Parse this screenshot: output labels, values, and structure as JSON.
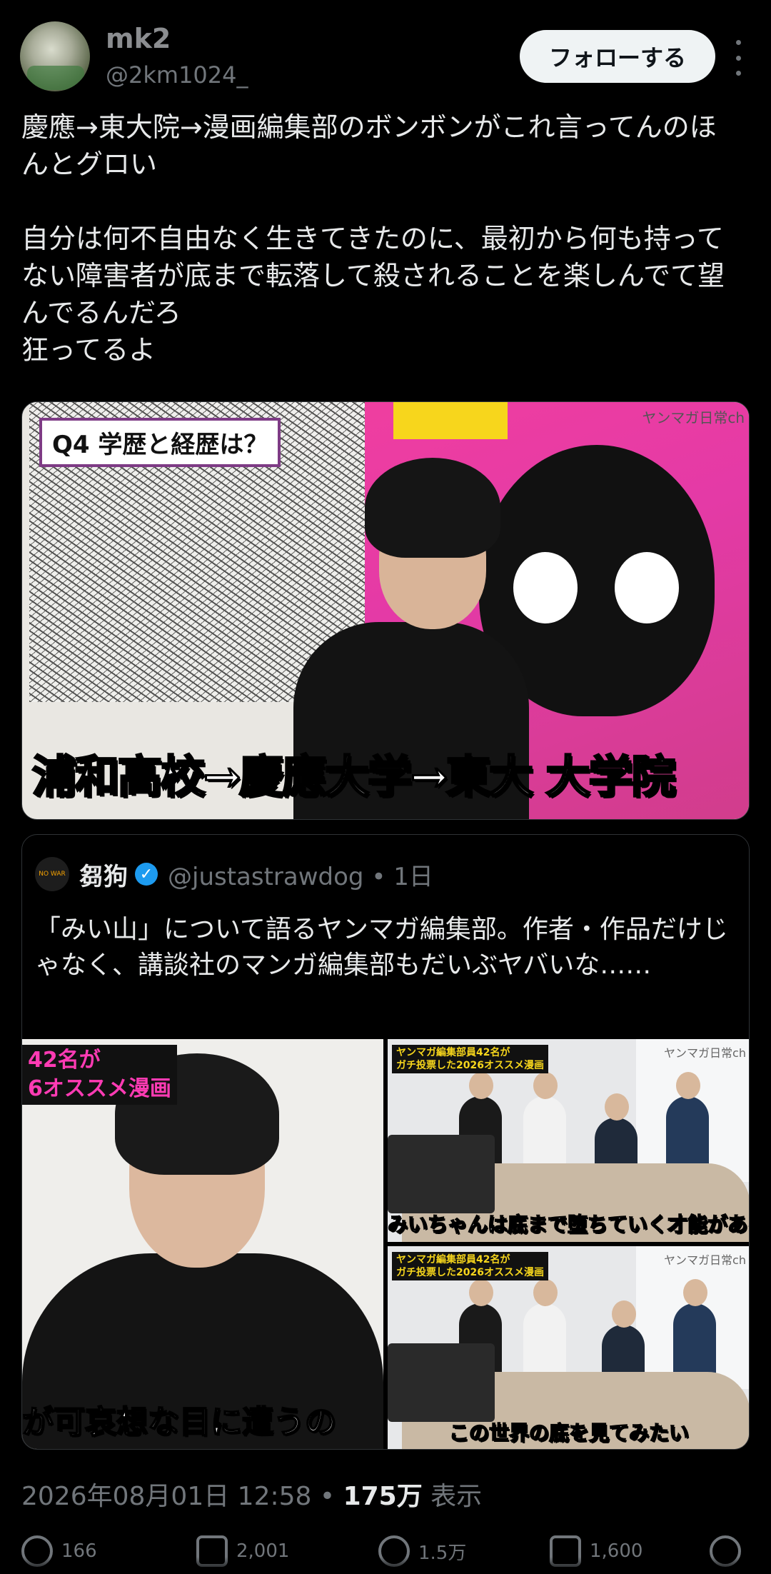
{
  "author": {
    "name": "mk2",
    "handle": "@2km1024_",
    "follow_label": "フォローする"
  },
  "post": {
    "text": "慶應→東大院→漫画編集部のボンボンがこれ言ってんのほんとグロい\n\n自分は何不自由なく生きてきたのに、最初から何も持ってない障害者が底まで転落して殺されることを楽しんでて望んでるんだろ\n狂ってるよ"
  },
  "media": {
    "question_label": "Q4 学歴と経歴は？",
    "watermark": "ヤンマガ日常ch",
    "caption": "浦和高校→慶應大学→東大 大学院"
  },
  "quote": {
    "name": "芻狗",
    "handle": "@justastrawdog",
    "time": "1日",
    "avatar_text": "NO WAR",
    "text": "「みい山」について語るヤンマガ編集部。作者・作品だけじゃなく、講談社のマンガ編集部もだいぶヤバいな……",
    "image1": {
      "banner_top": "42名が",
      "banner_bottom": "6オススメ漫画",
      "subtitle": "が可哀想な目に遭うの"
    },
    "image2": {
      "banner": "ヤンマガ編集部員42名が\nガチ投票した2026オススメ漫画",
      "watermark": "ヤンマガ日常ch",
      "subtitle": "みいちゃんは底まで堕ちていく才能がある"
    },
    "image3": {
      "banner": "ヤンマガ編集部員42名が\nガチ投票した2026オススメ漫画",
      "watermark": "ヤンマガ日常ch",
      "subtitle": "この世界の底を見てみたい"
    }
  },
  "meta": {
    "timestamp": "2026年08月01日 12:58",
    "views": "175万",
    "views_label": "表示"
  },
  "actions": {
    "replies": "166",
    "reposts": "2,001",
    "likes": "1.5万",
    "bookmarks": "1,600"
  },
  "colors": {
    "background": "#000000",
    "text": "#e7e9ea",
    "muted": "#71767b",
    "verified": "#1d9bf0"
  }
}
